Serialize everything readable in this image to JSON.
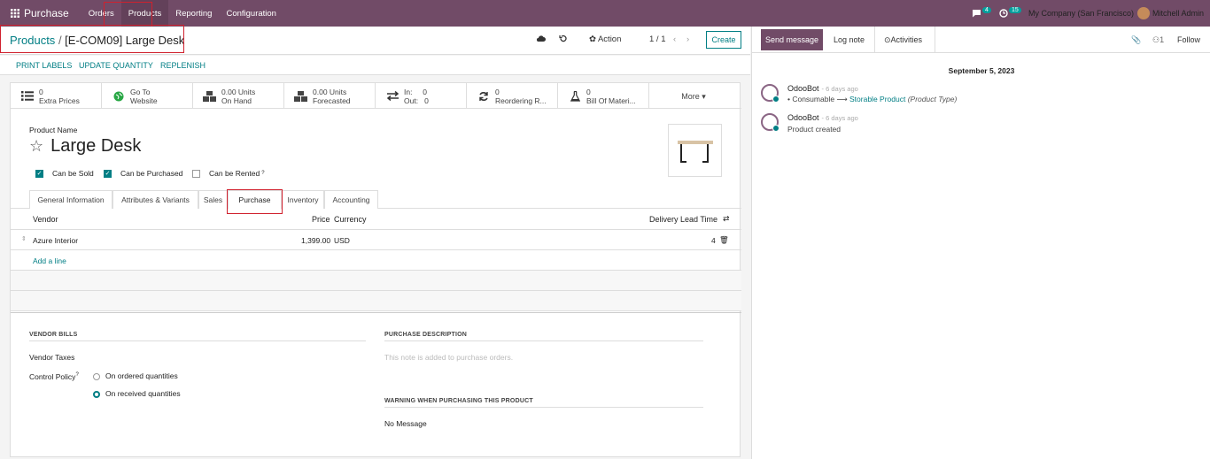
{
  "topbar": {
    "app_name": "Purchase",
    "menu": [
      "Orders",
      "Products",
      "Reporting",
      "Configuration"
    ],
    "active_menu": "Products",
    "messages_count": "4",
    "activities_count": "15",
    "company": "My Company (San Francisco)",
    "user": "Mitchell Admin",
    "accent_color": "#714b67"
  },
  "control_panel": {
    "breadcrumb_root": "Products",
    "breadcrumb_current": "[E-COM09] Large Desk",
    "action_label": "Action",
    "pager": "1 / 1",
    "create_label": "Create"
  },
  "statusbar": {
    "buttons": [
      "PRINT LABELS",
      "UPDATE QUANTITY",
      "REPLENISH"
    ]
  },
  "smart_buttons": [
    {
      "icon": "list-icon",
      "line1": "0",
      "line2": "Extra Prices"
    },
    {
      "icon": "globe-icon",
      "line1": "Go To",
      "line2": "Website"
    },
    {
      "icon": "cubes-icon",
      "line1": "0.00 Units",
      "line2": "On Hand"
    },
    {
      "icon": "cubes-icon",
      "line1": "0.00 Units",
      "line2": "Forecasted"
    },
    {
      "icon": "exchange-icon",
      "line1": "In:     0",
      "line2": "Out:   0"
    },
    {
      "icon": "refresh-icon",
      "line1": "0",
      "line2": "Reordering R..."
    },
    {
      "icon": "flask-icon",
      "line1": "0",
      "line2": "Bill Of Materi..."
    }
  ],
  "more_label": "More ▾",
  "product": {
    "name_label": "Product Name",
    "name": "Large Desk",
    "can_be_sold": "Can be Sold",
    "can_be_purchased": "Can be Purchased",
    "can_be_rented": "Can be Rented"
  },
  "tabs": [
    "General Information",
    "Attributes & Variants",
    "Sales",
    "Purchase",
    "Inventory",
    "Accounting"
  ],
  "active_tab": "Purchase",
  "vendor_table": {
    "headers": {
      "vendor": "Vendor",
      "price": "Price",
      "currency": "Currency",
      "lead_time": "Delivery Lead Time"
    },
    "rows": [
      {
        "vendor": "Azure Interior",
        "price": "1,399.00",
        "currency": "USD",
        "lead_time": "4"
      }
    ],
    "add_line": "Add a line"
  },
  "vendor_bills": {
    "title": "VENDOR BILLS",
    "vendor_taxes": "Vendor Taxes",
    "control_policy": "Control Policy",
    "option_ordered": "On ordered quantities",
    "option_received": "On received quantities",
    "selected": "On received quantities"
  },
  "purchase_description": {
    "title": "PURCHASE DESCRIPTION",
    "placeholder": "This note is added to purchase orders."
  },
  "warning": {
    "title": "WARNING WHEN PURCHASING THIS PRODUCT",
    "value": "No Message"
  },
  "chatter": {
    "send_message": "Send message",
    "log_note": "Log note",
    "activities": "Activities",
    "followers": "1",
    "follow": "Follow",
    "date": "September 5, 2023",
    "messages": [
      {
        "author": "OdooBot",
        "ago": "- 6 days ago",
        "from": "Consumable",
        "to": "Storable Product",
        "field": "(Product Type)"
      },
      {
        "author": "OdooBot",
        "ago": "- 6 days ago",
        "body": "Product created"
      }
    ]
  }
}
